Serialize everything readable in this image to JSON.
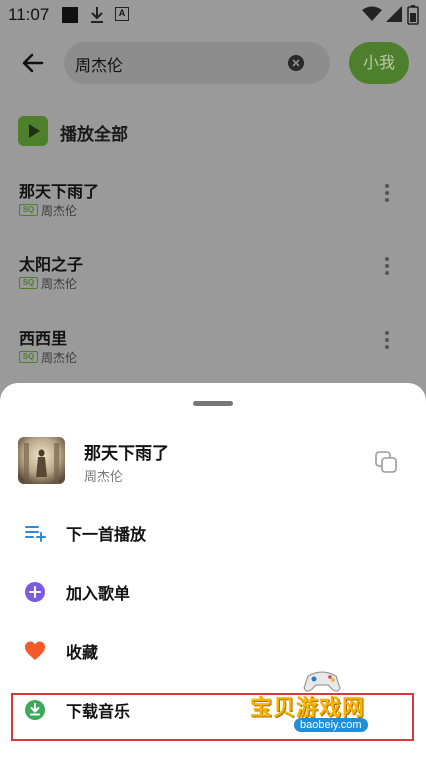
{
  "status_bar": {
    "time": "11:07",
    "notif_letter": "A"
  },
  "search": {
    "query": "周杰伦",
    "submit_label": "小我"
  },
  "list": {
    "play_all_label": "播放全部",
    "songs": [
      {
        "title": "那天下雨了",
        "badge": "SQ",
        "artist": "周杰伦"
      },
      {
        "title": "太阳之子",
        "badge": "SQ",
        "artist": "周杰伦"
      },
      {
        "title": "西西里",
        "badge": "SQ",
        "artist": "周杰伦"
      }
    ]
  },
  "sheet": {
    "song_title": "那天下雨了",
    "song_artist": "周杰伦",
    "actions": [
      {
        "label": "下一首播放",
        "icon": "play-next-icon",
        "color": "#2d8ad8"
      },
      {
        "label": "加入歌单",
        "icon": "add-to-playlist-icon",
        "color": "#7b5ce0"
      },
      {
        "label": "收藏",
        "icon": "heart-icon",
        "color": "#f25a2a"
      },
      {
        "label": "下载音乐",
        "icon": "download-icon",
        "color": "#3caa5a"
      }
    ]
  },
  "watermark": {
    "text": "宝贝游戏网",
    "url": "baobeiy.com"
  },
  "colors": {
    "accent": "#4e7f2c",
    "highlight": "#d63a3a",
    "overlay": "#9a9a9a"
  }
}
